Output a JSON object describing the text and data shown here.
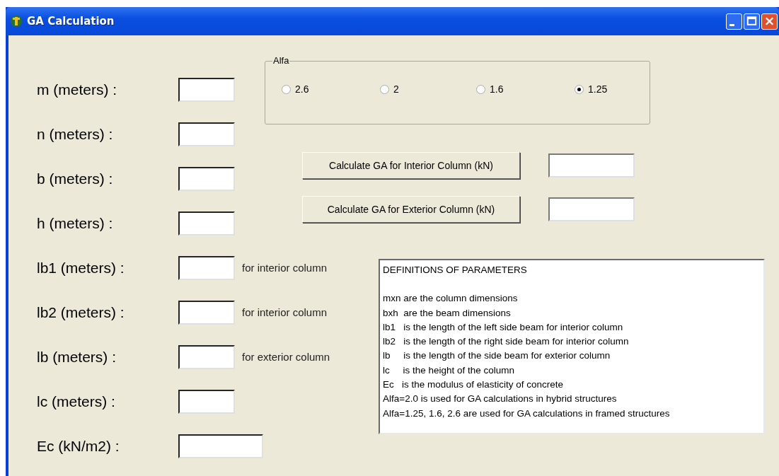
{
  "window": {
    "title": "GA Calculation"
  },
  "fields": [
    {
      "label": "m (meters) :",
      "wide": false
    },
    {
      "label": "n (meters) :",
      "wide": false
    },
    {
      "label": "b (meters) :",
      "wide": false
    },
    {
      "label": "h (meters) :",
      "wide": false
    },
    {
      "label": "lb1 (meters) :",
      "wide": false,
      "note": "for interior column"
    },
    {
      "label": "lb2 (meters) :",
      "wide": false,
      "note": "for interior column"
    },
    {
      "label": "lb (meters) :",
      "wide": false,
      "note": "for exterior column"
    },
    {
      "label": "lc (meters) :",
      "wide": false
    },
    {
      "label": "Ec (kN/m2) :",
      "wide": true
    }
  ],
  "alfa": {
    "title": "Alfa",
    "options": [
      {
        "label": "2.6",
        "selected": false
      },
      {
        "label": "2",
        "selected": false
      },
      {
        "label": "1.6",
        "selected": false
      },
      {
        "label": "1.25",
        "selected": true
      }
    ]
  },
  "actions": [
    {
      "label": "Calculate GA for Interior Column (kN)"
    },
    {
      "label": "Calculate GA for Exterior Column (kN)"
    }
  ],
  "definitions": {
    "heading": "DEFINITIONS OF PARAMETERS",
    "lines": [
      "mxn are the column dimensions",
      "bxh  are the beam dimensions",
      "lb1   is the length of the left side beam for interior column",
      "lb2   is the length of the right side beam for interior column",
      "lb     is the length of the side beam for exterior column",
      "lc     is the height of the column",
      "Ec   is the modulus of elasticity of concrete",
      "Alfa=2.0 is used for GA calculations in hybrid structures",
      "Alfa=1.25, 1.6, 2.6 are used for GA calculations in framed structures"
    ]
  }
}
